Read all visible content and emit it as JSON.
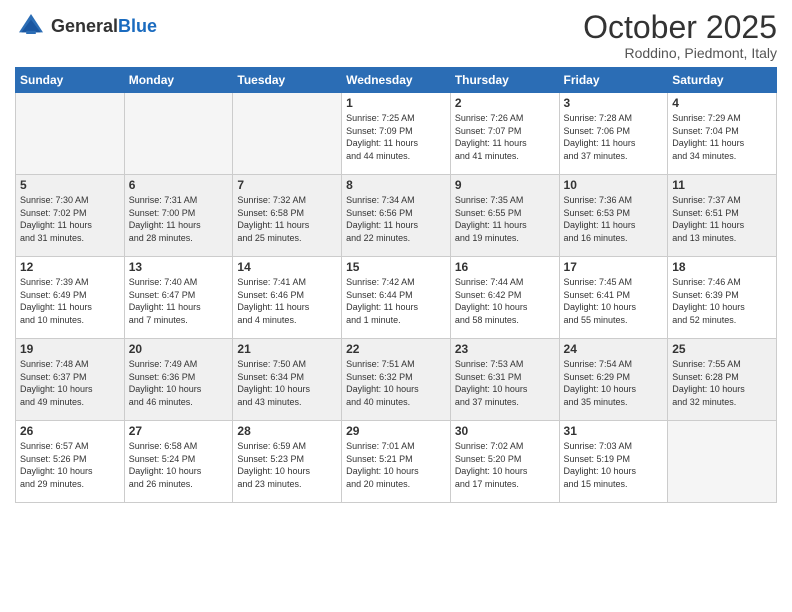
{
  "header": {
    "logo_general": "General",
    "logo_blue": "Blue",
    "title": "October 2025",
    "location": "Roddino, Piedmont, Italy"
  },
  "weekdays": [
    "Sunday",
    "Monday",
    "Tuesday",
    "Wednesday",
    "Thursday",
    "Friday",
    "Saturday"
  ],
  "weeks": [
    [
      {
        "day": "",
        "info": ""
      },
      {
        "day": "",
        "info": ""
      },
      {
        "day": "",
        "info": ""
      },
      {
        "day": "1",
        "info": "Sunrise: 7:25 AM\nSunset: 7:09 PM\nDaylight: 11 hours\nand 44 minutes."
      },
      {
        "day": "2",
        "info": "Sunrise: 7:26 AM\nSunset: 7:07 PM\nDaylight: 11 hours\nand 41 minutes."
      },
      {
        "day": "3",
        "info": "Sunrise: 7:28 AM\nSunset: 7:06 PM\nDaylight: 11 hours\nand 37 minutes."
      },
      {
        "day": "4",
        "info": "Sunrise: 7:29 AM\nSunset: 7:04 PM\nDaylight: 11 hours\nand 34 minutes."
      }
    ],
    [
      {
        "day": "5",
        "info": "Sunrise: 7:30 AM\nSunset: 7:02 PM\nDaylight: 11 hours\nand 31 minutes."
      },
      {
        "day": "6",
        "info": "Sunrise: 7:31 AM\nSunset: 7:00 PM\nDaylight: 11 hours\nand 28 minutes."
      },
      {
        "day": "7",
        "info": "Sunrise: 7:32 AM\nSunset: 6:58 PM\nDaylight: 11 hours\nand 25 minutes."
      },
      {
        "day": "8",
        "info": "Sunrise: 7:34 AM\nSunset: 6:56 PM\nDaylight: 11 hours\nand 22 minutes."
      },
      {
        "day": "9",
        "info": "Sunrise: 7:35 AM\nSunset: 6:55 PM\nDaylight: 11 hours\nand 19 minutes."
      },
      {
        "day": "10",
        "info": "Sunrise: 7:36 AM\nSunset: 6:53 PM\nDaylight: 11 hours\nand 16 minutes."
      },
      {
        "day": "11",
        "info": "Sunrise: 7:37 AM\nSunset: 6:51 PM\nDaylight: 11 hours\nand 13 minutes."
      }
    ],
    [
      {
        "day": "12",
        "info": "Sunrise: 7:39 AM\nSunset: 6:49 PM\nDaylight: 11 hours\nand 10 minutes."
      },
      {
        "day": "13",
        "info": "Sunrise: 7:40 AM\nSunset: 6:47 PM\nDaylight: 11 hours\nand 7 minutes."
      },
      {
        "day": "14",
        "info": "Sunrise: 7:41 AM\nSunset: 6:46 PM\nDaylight: 11 hours\nand 4 minutes."
      },
      {
        "day": "15",
        "info": "Sunrise: 7:42 AM\nSunset: 6:44 PM\nDaylight: 11 hours\nand 1 minute."
      },
      {
        "day": "16",
        "info": "Sunrise: 7:44 AM\nSunset: 6:42 PM\nDaylight: 10 hours\nand 58 minutes."
      },
      {
        "day": "17",
        "info": "Sunrise: 7:45 AM\nSunset: 6:41 PM\nDaylight: 10 hours\nand 55 minutes."
      },
      {
        "day": "18",
        "info": "Sunrise: 7:46 AM\nSunset: 6:39 PM\nDaylight: 10 hours\nand 52 minutes."
      }
    ],
    [
      {
        "day": "19",
        "info": "Sunrise: 7:48 AM\nSunset: 6:37 PM\nDaylight: 10 hours\nand 49 minutes."
      },
      {
        "day": "20",
        "info": "Sunrise: 7:49 AM\nSunset: 6:36 PM\nDaylight: 10 hours\nand 46 minutes."
      },
      {
        "day": "21",
        "info": "Sunrise: 7:50 AM\nSunset: 6:34 PM\nDaylight: 10 hours\nand 43 minutes."
      },
      {
        "day": "22",
        "info": "Sunrise: 7:51 AM\nSunset: 6:32 PM\nDaylight: 10 hours\nand 40 minutes."
      },
      {
        "day": "23",
        "info": "Sunrise: 7:53 AM\nSunset: 6:31 PM\nDaylight: 10 hours\nand 37 minutes."
      },
      {
        "day": "24",
        "info": "Sunrise: 7:54 AM\nSunset: 6:29 PM\nDaylight: 10 hours\nand 35 minutes."
      },
      {
        "day": "25",
        "info": "Sunrise: 7:55 AM\nSunset: 6:28 PM\nDaylight: 10 hours\nand 32 minutes."
      }
    ],
    [
      {
        "day": "26",
        "info": "Sunrise: 6:57 AM\nSunset: 5:26 PM\nDaylight: 10 hours\nand 29 minutes."
      },
      {
        "day": "27",
        "info": "Sunrise: 6:58 AM\nSunset: 5:24 PM\nDaylight: 10 hours\nand 26 minutes."
      },
      {
        "day": "28",
        "info": "Sunrise: 6:59 AM\nSunset: 5:23 PM\nDaylight: 10 hours\nand 23 minutes."
      },
      {
        "day": "29",
        "info": "Sunrise: 7:01 AM\nSunset: 5:21 PM\nDaylight: 10 hours\nand 20 minutes."
      },
      {
        "day": "30",
        "info": "Sunrise: 7:02 AM\nSunset: 5:20 PM\nDaylight: 10 hours\nand 17 minutes."
      },
      {
        "day": "31",
        "info": "Sunrise: 7:03 AM\nSunset: 5:19 PM\nDaylight: 10 hours\nand 15 minutes."
      },
      {
        "day": "",
        "info": ""
      }
    ]
  ]
}
